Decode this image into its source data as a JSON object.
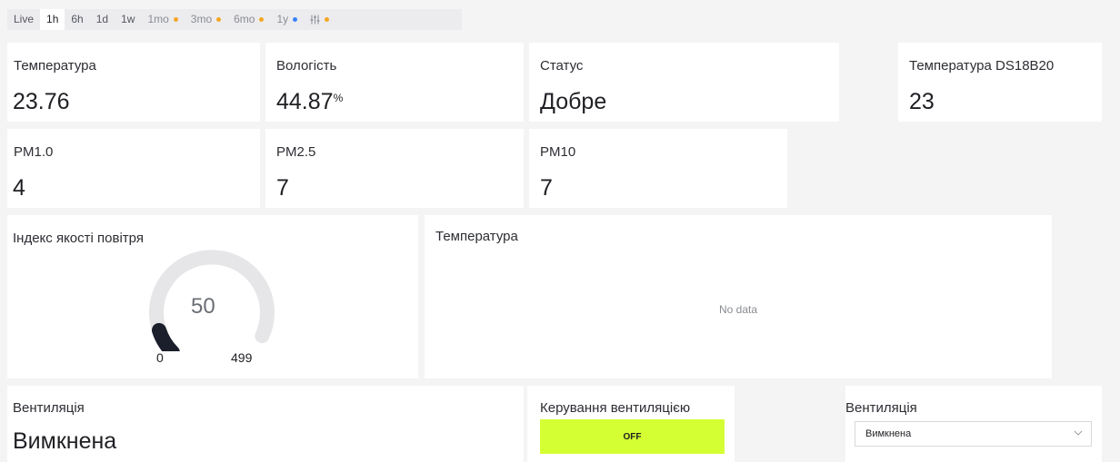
{
  "time_range": {
    "items": [
      {
        "label": "Live",
        "dot": null,
        "active": false
      },
      {
        "label": "1h",
        "dot": null,
        "active": true
      },
      {
        "label": "6h",
        "dot": null,
        "active": false
      },
      {
        "label": "1d",
        "dot": null,
        "active": false
      },
      {
        "label": "1w",
        "dot": null,
        "active": false
      },
      {
        "label": "1mo",
        "dot": "#f5a623",
        "active": false
      },
      {
        "label": "3mo",
        "dot": "#f5a623",
        "active": false
      },
      {
        "label": "6mo",
        "dot": "#f5a623",
        "active": false
      },
      {
        "label": "1y",
        "dot": "#3b82f6",
        "active": false
      }
    ],
    "custom_dot": "#f5a623",
    "custom_icon": "sliders-icon"
  },
  "widgets": {
    "temperature": {
      "title": "Температура",
      "value": "23.76"
    },
    "humidity": {
      "title": "Вологість",
      "value": "44.87",
      "unit": "%"
    },
    "status": {
      "title": "Статус",
      "value": "Добре"
    },
    "temperature_ds18b20": {
      "title": "Температура DS18B20",
      "value": "23"
    },
    "pm1": {
      "title": "PM1.0",
      "value": "4"
    },
    "pm25": {
      "title": "PM2.5",
      "value": "7"
    },
    "pm10": {
      "title": "PM10",
      "value": "7"
    },
    "aqi": {
      "title": "Індекс якості повітря",
      "value": "50",
      "min": "0",
      "max": "499",
      "fraction": 0.1
    },
    "temperature_chart": {
      "title": "Температура",
      "empty_text": "No data"
    },
    "ventilation": {
      "title": "Вентиляція",
      "value": "Вимкнена"
    },
    "ventilation_control": {
      "title": "Керування вентиляцією",
      "button_label": "OFF",
      "button_color": "#d4ff33"
    },
    "ventilation_select": {
      "title": "Вентиляція",
      "selected": "Вимкнена"
    }
  }
}
